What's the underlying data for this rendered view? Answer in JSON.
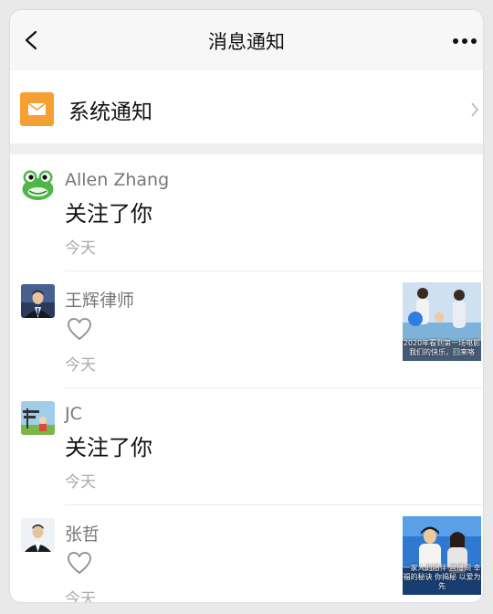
{
  "header": {
    "title": "消息通知",
    "back_icon": "chevron-left-icon",
    "more_icon": "more-dots-icon"
  },
  "system": {
    "label": "系统通知",
    "icon": "mail-icon",
    "icon_color": "#f5a033"
  },
  "notifications": [
    {
      "name": "Allen Zhang",
      "action": "关注了你",
      "time": "今天",
      "type": "follow",
      "avatar": "frog-avatar"
    },
    {
      "name": "王辉律师",
      "action": "",
      "time": "今天",
      "type": "like",
      "avatar": "man-suit-avatar",
      "thumb_caption": "2020年看到第一场电影 我们的快乐，回来咯"
    },
    {
      "name": "JC",
      "action": "关注了你",
      "time": "今天",
      "type": "follow",
      "avatar": "cartoon-avatar"
    },
    {
      "name": "张哲",
      "action": "",
      "time": "今天",
      "type": "like",
      "avatar": "man-suit-avatar",
      "thumb_caption": "一家人的陪伴 直播间 幸福的秘诀 你揭秘 以爱为先"
    }
  ]
}
